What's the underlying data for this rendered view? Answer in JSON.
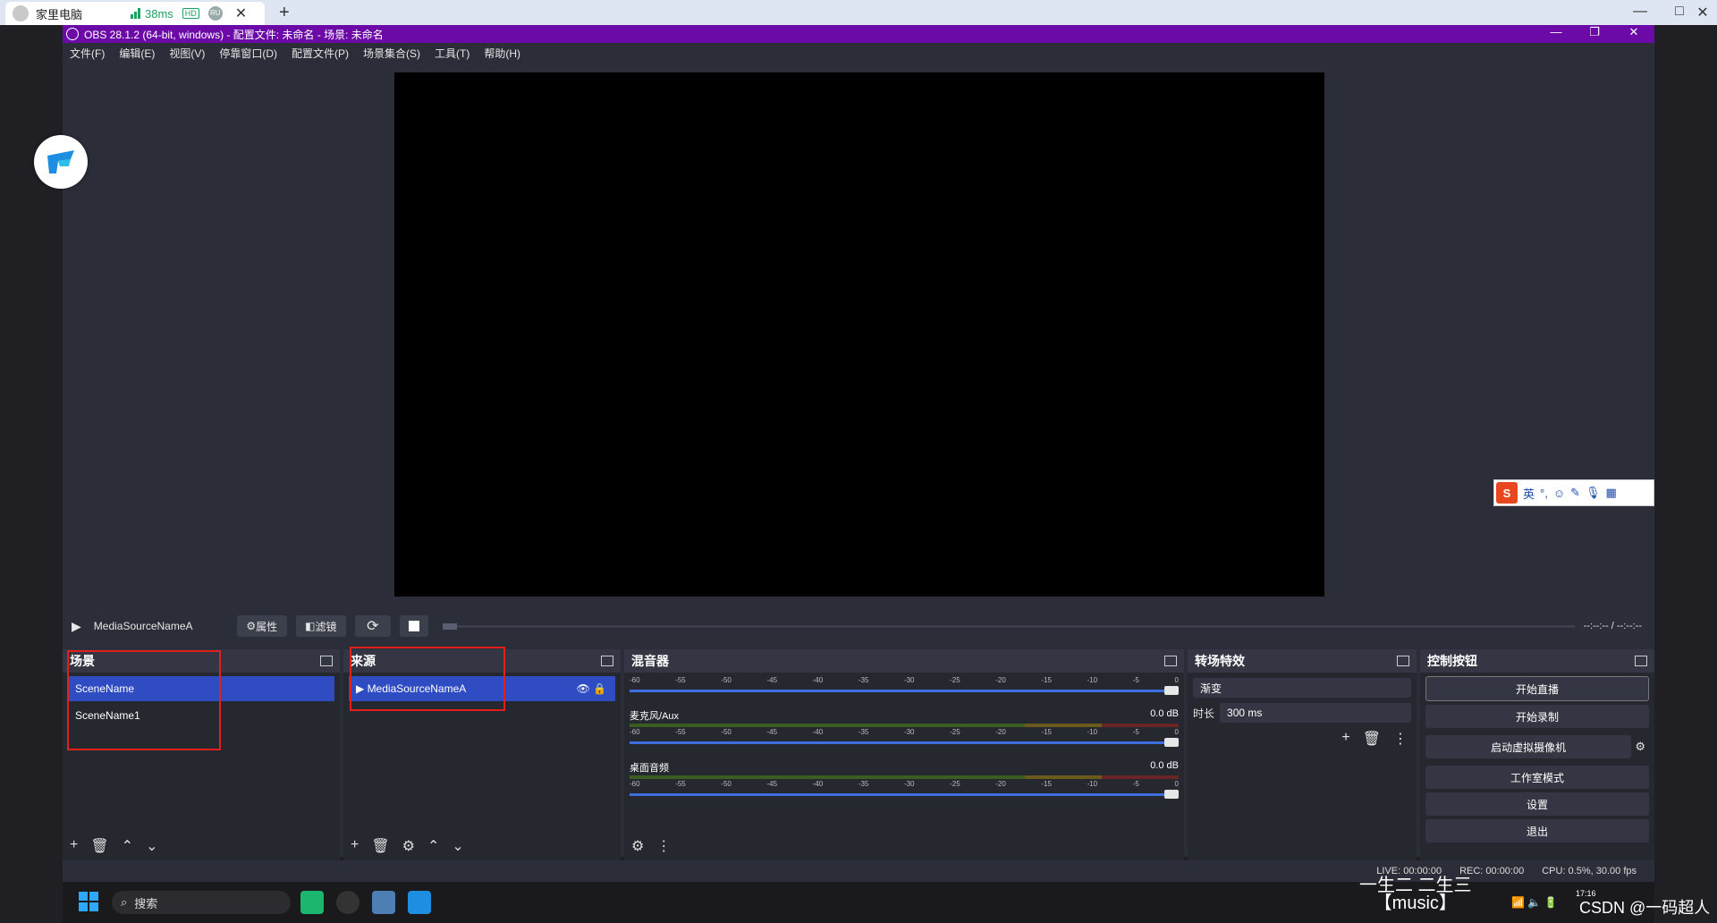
{
  "rd": {
    "tab_title": "家里电脑",
    "latency": "38ms",
    "hd_badge": "HD",
    "ru_badge": "RU",
    "close_glyph": "✕",
    "new_tab_glyph": "+",
    "min_glyph": "—",
    "max_glyph": "□",
    "close_win_glyph": "✕"
  },
  "obs": {
    "title": "OBS 28.1.2 (64-bit, windows) - 配置文件: 未命名 - 场景: 未命名",
    "min_glyph": "—",
    "max_glyph": "❐",
    "close_glyph": "✕",
    "menu": [
      "文件(F)",
      "编辑(E)",
      "视图(V)",
      "停靠窗口(D)",
      "配置文件(P)",
      "场景集合(S)",
      "工具(T)",
      "帮助(H)"
    ]
  },
  "media": {
    "source_name": "MediaSourceNameA",
    "properties_label": "属性",
    "filters_label": "滤镜",
    "time": "--:--:-- / --:--:--"
  },
  "scenes": {
    "title": "场景",
    "items": [
      "SceneName",
      "SceneName1"
    ]
  },
  "sources": {
    "title": "来源",
    "items": [
      "MediaSourceNameA"
    ]
  },
  "mixer": {
    "title": "混音器",
    "scale": [
      "-60",
      "-55",
      "-50",
      "-45",
      "-40",
      "-35",
      "-30",
      "-25",
      "-20",
      "-15",
      "-10",
      "-5",
      "0"
    ],
    "channels": [
      {
        "name": "麦克风/Aux",
        "db": "0.0 dB"
      },
      {
        "name": "桌面音频",
        "db": "0.0 dB"
      }
    ]
  },
  "transitions": {
    "title": "转场特效",
    "selected": "渐变",
    "duration_label": "时长",
    "duration_value": "300 ms"
  },
  "controls": {
    "title": "控制按钮",
    "buttons": [
      "开始直播",
      "开始录制",
      "启动虚拟摄像机",
      "工作室模式",
      "设置",
      "退出"
    ]
  },
  "status": {
    "live": "LIVE: 00:00:00",
    "rec": "REC: 00:00:00",
    "cpu": "CPU: 0.5%, 30.00 fps"
  },
  "ime": {
    "logo": "S",
    "lang": "英"
  },
  "taskbar": {
    "search_label": "搜索",
    "music_line1": "一生二 二生三",
    "music_line2": "【music】",
    "clock_time": "17:16",
    "watermark": "CSDN @一码超人"
  },
  "colors": {
    "titlebar": "#6b0aa6",
    "selection": "#2f4cc2",
    "highlight_box": "#e0201a",
    "panel": "#262830"
  }
}
